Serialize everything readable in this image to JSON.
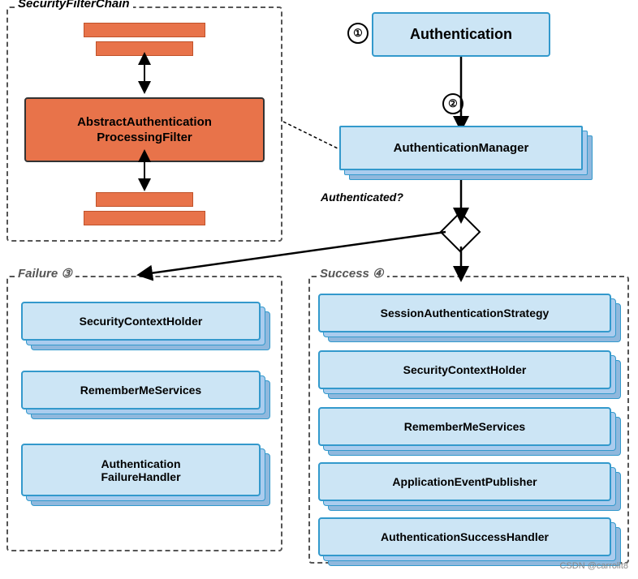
{
  "left_panel": {
    "title": "SecurityFilterChain",
    "filter_box_line1": "AbstractAuthentication",
    "filter_box_line2": "ProcessingFilter"
  },
  "right_flow": {
    "auth_label": "Authentication",
    "auth_manager_label": "AuthenticationManager",
    "authenticated_label": "Authenticated?",
    "step1": "①",
    "step2": "②"
  },
  "failure_panel": {
    "title": "Failure  ③",
    "items": [
      "SecurityContextHolder",
      "RememberMeServices",
      "Authentication\nFailureHandler"
    ]
  },
  "success_panel": {
    "title": "Success  ④",
    "items": [
      "SessionAuthenticationStrategy",
      "SecurityContextHolder",
      "RememberMeServices",
      "ApplicationEventPublisher",
      "AuthenticationSuccessHandler"
    ]
  },
  "watermark": "CSDN @carrollt8"
}
